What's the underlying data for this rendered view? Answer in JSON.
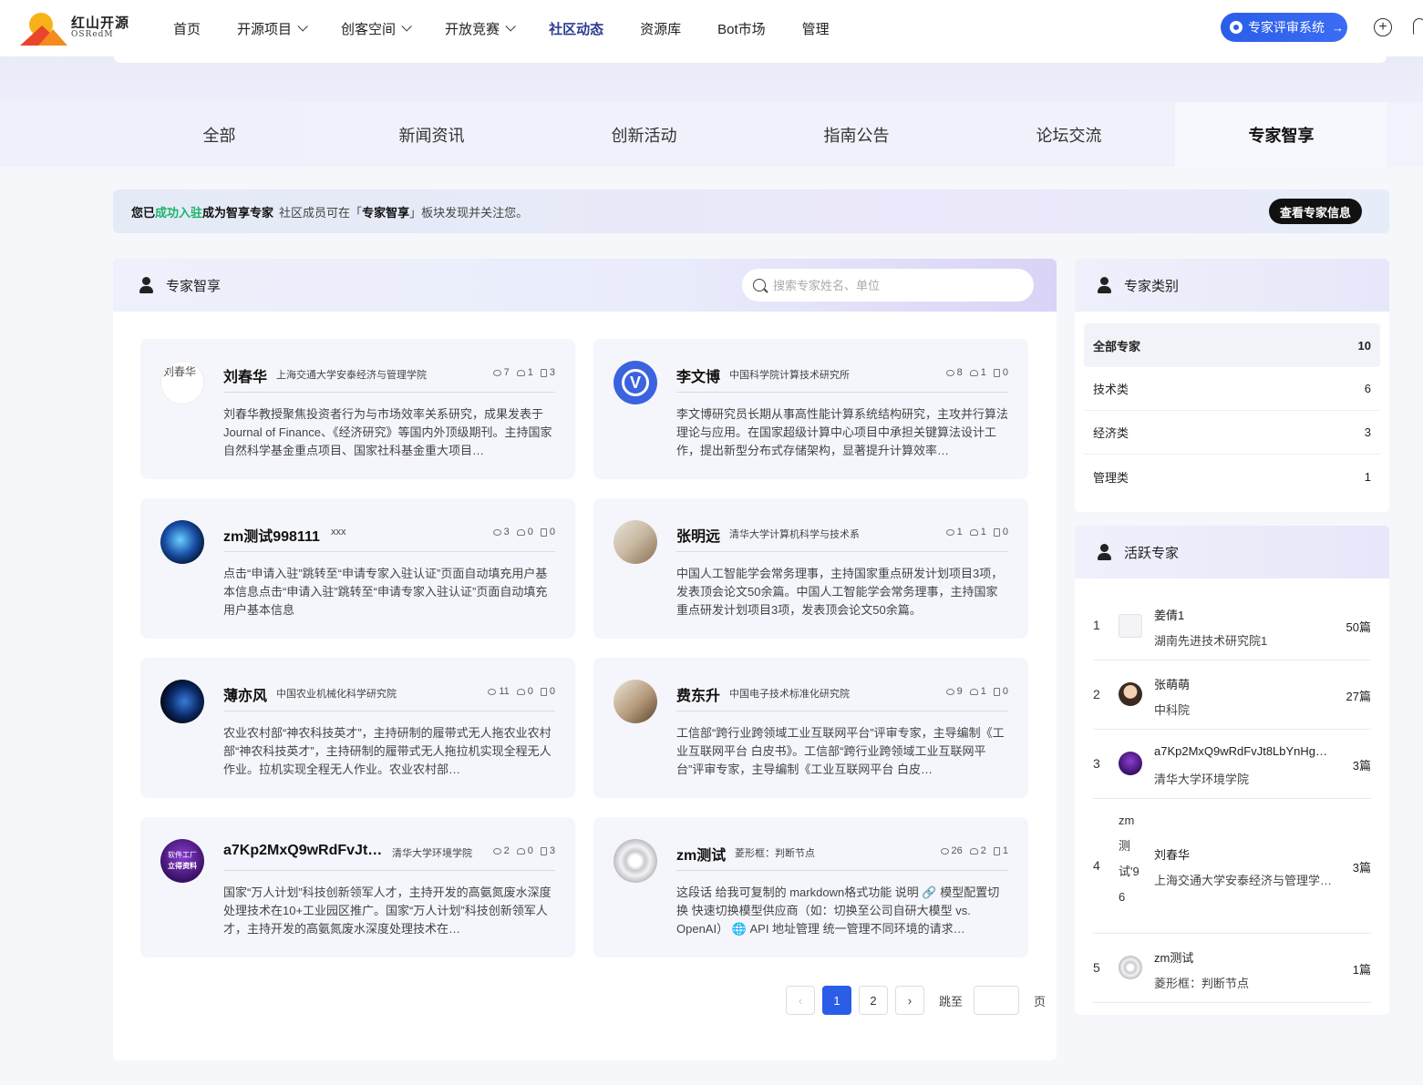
{
  "logo": {
    "cn": "红山开源",
    "en": "OSRedM"
  },
  "nav": [
    {
      "label": "首页",
      "dropdown": false
    },
    {
      "label": "开源项目",
      "dropdown": true
    },
    {
      "label": "创客空间",
      "dropdown": true
    },
    {
      "label": "开放竞赛",
      "dropdown": true
    },
    {
      "label": "社区动态",
      "dropdown": false
    },
    {
      "label": "资源库",
      "dropdown": false
    },
    {
      "label": "Bot市场",
      "dropdown": false
    },
    {
      "label": "管理",
      "dropdown": false
    }
  ],
  "review_button": "专家评审系统",
  "tabs": [
    "全部",
    "新闻资讯",
    "创新活动",
    "指南公告",
    "论坛交流",
    "专家智享"
  ],
  "active_tab": "专家智享",
  "notice": {
    "part1": "您已",
    "part2": "成功入驻",
    "part3": "成为智享专家",
    "part4": "社区成员可在「",
    "part5": "专家智享",
    "part6": "」板块发现并关注您。",
    "button": "查看专家信息"
  },
  "main": {
    "title": "专家智享",
    "search_placeholder": "搜索专家姓名、单位"
  },
  "experts": [
    {
      "name": "刘春华",
      "org": "上海交通大学安泰经济与管理学院",
      "views": "7",
      "likes": "1",
      "docs": "3",
      "avatar_alt": "刘春华",
      "desc": "刘春华教授聚焦投资者行为与市场效率关系研究，成果发表于 Journal of Finance、《经济研究》等国内外顶级期刊。主持国家自然科学基金重点项目、国家社科基金重大项目…"
    },
    {
      "name": "李文博",
      "org": "中国科学院计算技术研究所",
      "views": "8",
      "likes": "1",
      "docs": "0",
      "desc": "李文博研究员长期从事高性能计算系统结构研究，主攻并行算法理论与应用。在国家超级计算中心项目中承担关键算法设计工作，提出新型分布式存储架构，显著提升计算效率…"
    },
    {
      "name": "zm测试998111",
      "org": "xxx",
      "views": "3",
      "likes": "0",
      "docs": "0",
      "desc": "点击“申请入驻”跳转至“申请专家入驻认证”页面自动填充用户基本信息点击“申请入驻”跳转至“申请专家入驻认证”页面自动填充用户基本信息"
    },
    {
      "name": "张明远",
      "org": "清华大学计算机科学与技术系",
      "views": "1",
      "likes": "1",
      "docs": "0",
      "desc": "中国人工智能学会常务理事，主持国家重点研发计划项目3项，发表顶会论文50余篇。中国人工智能学会常务理事，主持国家重点研发计划项目3项，发表顶会论文50余篇。"
    },
    {
      "name": "薄亦风",
      "org": "中国农业机械化科学研究院",
      "views": "11",
      "likes": "0",
      "docs": "0",
      "desc": "农业农村部“神农科技英才”，主持研制的履带式无人拖农业农村部“神农科技英才”，主持研制的履带式无人拖拉机实现全程无人作业。拉机实现全程无人作业。农业农村部…"
    },
    {
      "name": "费东升",
      "org": "中国电子技术标准化研究院",
      "views": "9",
      "likes": "1",
      "docs": "0",
      "desc": "工信部“跨行业跨领域工业互联网平台”评审专家，主导编制《工业互联网平台 白皮书》。工信部“跨行业跨领域工业互联网平台”评审专家，主导编制《工业互联网平台 白皮…"
    },
    {
      "name": "a7Kp2MxQ9wRdFvJt8…",
      "org": "清华大学环境学院",
      "views": "2",
      "likes": "0",
      "docs": "3",
      "avatar_text1": "软件工厂",
      "avatar_text2": "立得资料",
      "desc": "国家“万人计划”科技创新领军人才，主持开发的高氨氮废水深度处理技术在10+工业园区推广。国家“万人计划”科技创新领军人才，主持开发的高氨氮废水深度处理技术在…"
    },
    {
      "name": "zm测试",
      "org": "菱形框：判断节点",
      "views": "26",
      "likes": "2",
      "docs": "1",
      "desc": "这段话 给我可复制的 markdown格式功能 说明 🔗 模型配置切换 快速切换模型供应商（如：切换至公司自研大模型 vs. OpenAI） 🌐 API 地址管理 统一管理不同环境的请求…"
    }
  ],
  "pagination": {
    "pages": [
      "1",
      "2"
    ],
    "current": "1",
    "jump_label": "跳至",
    "page_label": "页"
  },
  "categories": {
    "title": "专家类别",
    "items": [
      {
        "label": "全部专家",
        "count": "10"
      },
      {
        "label": "技术类",
        "count": "6"
      },
      {
        "label": "经济类",
        "count": "3"
      },
      {
        "label": "管理类",
        "count": "1"
      }
    ]
  },
  "active_experts": {
    "title": "活跃专家",
    "items": [
      {
        "rank": "1",
        "name": "姜倩1",
        "org": "湖南先进技术研究院1",
        "count": "50篇"
      },
      {
        "rank": "2",
        "name": "张萌萌",
        "org": "中科院",
        "count": "27篇"
      },
      {
        "rank": "3",
        "name": "a7Kp2MxQ9wRdFvJt8LbYnHg…",
        "org": "清华大学环境学院",
        "count": "3篇"
      },
      {
        "rank": "4",
        "name": "刘春华",
        "org": "上海交通大学安泰经济与管理学…",
        "count": "3篇",
        "avatar_alt": "zm测试'96"
      },
      {
        "rank": "5",
        "name": "zm测试",
        "org": "菱形框：判断节点",
        "count": "1篇"
      }
    ]
  },
  "colors": {
    "primary": "#2b5ee8",
    "success": "#1fb26a",
    "dark": "#111111"
  }
}
